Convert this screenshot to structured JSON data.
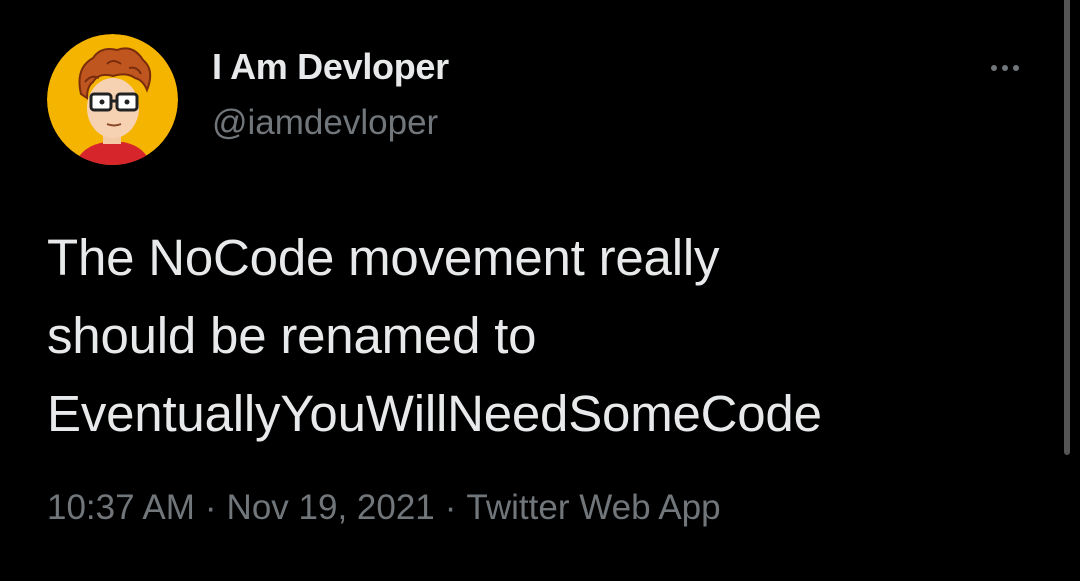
{
  "tweet": {
    "author": {
      "display_name": "I Am Devloper",
      "handle": "@iamdevloper",
      "avatar_icon": "cartoon-developer-avatar"
    },
    "text_lines": [
      "The NoCode movement really",
      "should be renamed to",
      "EventuallyYouWillNeedSomeCode"
    ],
    "time": "10:37 AM",
    "separator": "·",
    "date": "Nov 19, 2021",
    "source": "Twitter Web App",
    "more_icon": "more-dots-icon"
  },
  "colors": {
    "background": "#000000",
    "primary_text": "#e7e9ea",
    "secondary_text": "#71767b",
    "avatar_background": "#f5b400"
  }
}
